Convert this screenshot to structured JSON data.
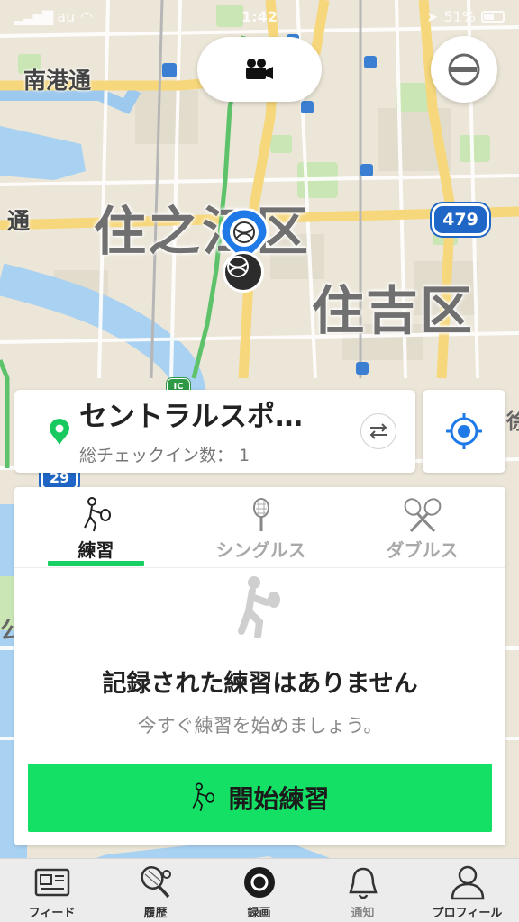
{
  "status_bar": {
    "carrier": "au",
    "time": "1:42",
    "battery": "51%"
  },
  "map": {
    "districts": [
      "住之江区",
      "住吉区"
    ],
    "streets": [
      "南港通",
      "通"
    ],
    "route_shields": [
      "479",
      "29",
      "IC"
    ],
    "partial_labels": [
      "公",
      "徐"
    ]
  },
  "top_controls": {
    "video_icon": "video-camera-icon",
    "mode_icon": "minus-circle-icon"
  },
  "location_card": {
    "name": "セントラルスポ…",
    "checkin_count": "総チェックイン数：  1",
    "pin_icon": "location-pin-icon",
    "swap_icon": "swap-arrows-icon",
    "locate_icon": "crosshair-locate-icon"
  },
  "practice_panel": {
    "tabs": [
      {
        "label": "練習",
        "icon": "player-swing-icon",
        "active": true
      },
      {
        "label": "シングルス",
        "icon": "racket-icon",
        "active": false
      },
      {
        "label": "ダブルス",
        "icon": "crossed-rackets-icon",
        "active": false
      }
    ],
    "empty_title": "記録された練習はありません",
    "empty_subtitle": "今すぐ練習を始めましょう。",
    "start_button_label": "開始練習"
  },
  "tab_bar": {
    "items": [
      {
        "label": "フィード",
        "icon": "feed-icon"
      },
      {
        "label": "履歴",
        "icon": "racket-ball-icon"
      },
      {
        "label": "録画",
        "icon": "record-icon"
      },
      {
        "label": "通知",
        "icon": "bell-icon"
      },
      {
        "label": "プロフィール",
        "icon": "profile-icon"
      }
    ]
  },
  "colors": {
    "accent_green": "#15e066",
    "tab_indicator": "#19cf63",
    "pin_blue": "#1f7ae8",
    "route_blue": "#1f66c6"
  }
}
